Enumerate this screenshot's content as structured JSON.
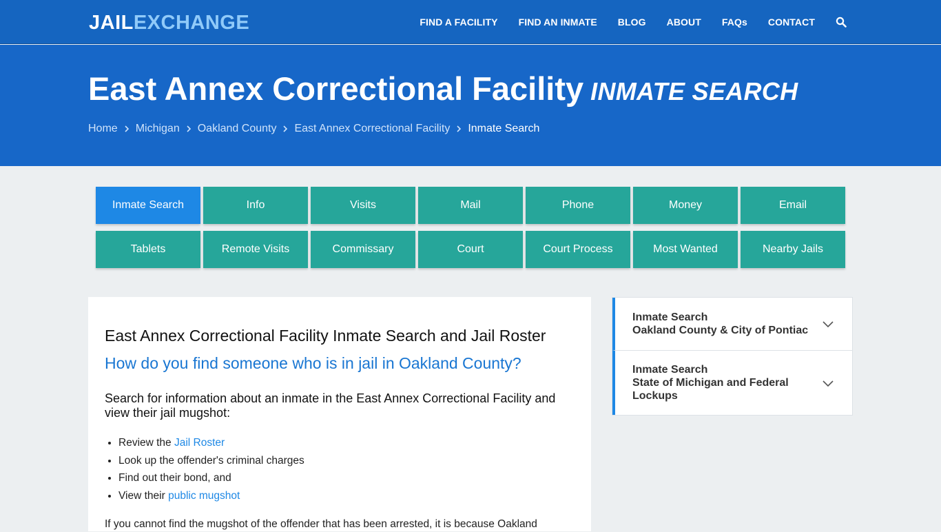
{
  "logo": {
    "part1": "JAIL",
    "part2": "EXCHANGE"
  },
  "nav": {
    "items": [
      "FIND A FACILITY",
      "FIND AN INMATE",
      "BLOG",
      "ABOUT",
      "FAQs",
      "CONTACT"
    ],
    "search_icon": "search-icon"
  },
  "hero": {
    "title": "East Annex Correctional Facility",
    "subtitle": "INMATE SEARCH",
    "breadcrumb": [
      "Home",
      "Michigan",
      "Oakland County",
      "East Annex Correctional Facility",
      "Inmate Search"
    ]
  },
  "tabs": {
    "row1": [
      "Inmate Search",
      "Info",
      "Visits",
      "Mail",
      "Phone",
      "Money",
      "Email"
    ],
    "row2": [
      "Tablets",
      "Remote Visits",
      "Commissary",
      "Court",
      "Court Process",
      "Most Wanted",
      "Nearby Jails"
    ],
    "active": "Inmate Search",
    "colors": {
      "tab": "#26a69a",
      "active": "#1e88e5"
    }
  },
  "main": {
    "heading": "East Annex Correctional Facility Inmate Search and Jail Roster",
    "question": "How do you find someone who is in jail in Oakland County?",
    "intro": "Search for information about an inmate in the East Annex Correctional Facility and view their jail mugshot:",
    "list": [
      {
        "pre": "Review the ",
        "link": "Jail Roster"
      },
      {
        "pre": "Look up the offender's criminal charges",
        "link": ""
      },
      {
        "pre": "Find out their bond, and",
        "link": ""
      },
      {
        "pre": "View their ",
        "link": "public mugshot"
      }
    ],
    "paragraph": "If you cannot find the mugshot of the offender that has been arrested, it is because Oakland"
  },
  "sidebar": {
    "items": [
      {
        "line1": "Inmate Search",
        "line2": "Oakland County & City of Pontiac"
      },
      {
        "line1": "Inmate Search",
        "line2": "State of Michigan and Federal Lockups"
      }
    ]
  },
  "colors": {
    "topbar": "#1565c0",
    "hero": "#1767c8",
    "accent": "#1e88e5",
    "logo_accent": "#90caf9"
  }
}
